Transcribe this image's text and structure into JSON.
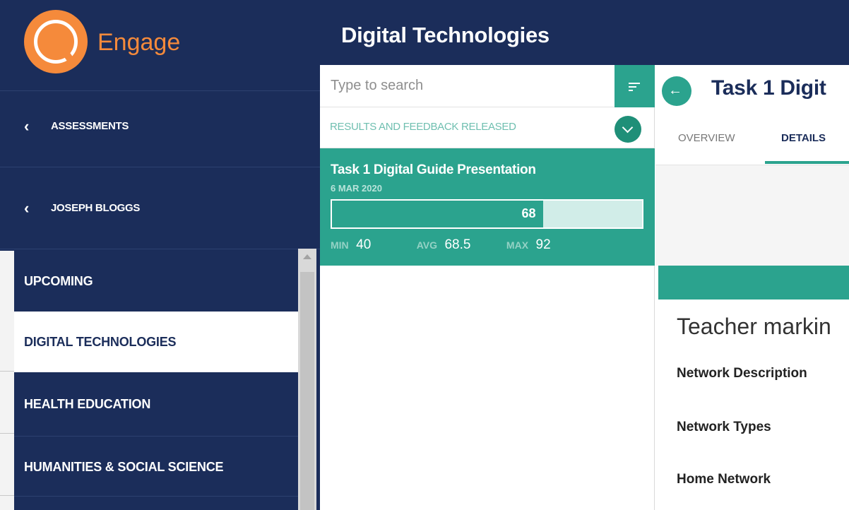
{
  "app": {
    "name": "Engage"
  },
  "sidebar": {
    "back_links": [
      {
        "label": "ASSESSMENTS"
      },
      {
        "label": "JOSEPH BLOGGS"
      }
    ],
    "subjects": [
      {
        "label": "UPCOMING"
      },
      {
        "label": "DIGITAL TECHNOLOGIES",
        "active": true
      },
      {
        "label": "HEALTH EDUCATION"
      },
      {
        "label": "HUMANITIES & SOCIAL SCIENCE"
      }
    ]
  },
  "header": {
    "title": "Digital Technologies"
  },
  "list_panel": {
    "search_placeholder": "Type to search",
    "status_filter": "RESULTS AND FEEDBACK RELEASED",
    "selected_item": {
      "title": "Task 1 Digital Guide Presentation",
      "date": "6 MAR 2020",
      "score": "68",
      "score_fraction": 0.68,
      "stats": {
        "min_label": "MIN",
        "min_value": "40",
        "avg_label": "AVG",
        "avg_value": "68.5",
        "max_label": "MAX",
        "max_value": "92"
      }
    }
  },
  "detail_panel": {
    "title": "Task 1 Digit",
    "tabs": [
      {
        "label": "OVERVIEW",
        "active": false
      },
      {
        "label": "DETAILS",
        "active": true
      }
    ],
    "section_heading": "Teacher markin",
    "criteria": [
      "Network Description",
      "Network Types",
      "Home Network"
    ]
  },
  "colors": {
    "navy": "#1b2d5a",
    "teal": "#2ba38e",
    "orange": "#f58a3b"
  }
}
